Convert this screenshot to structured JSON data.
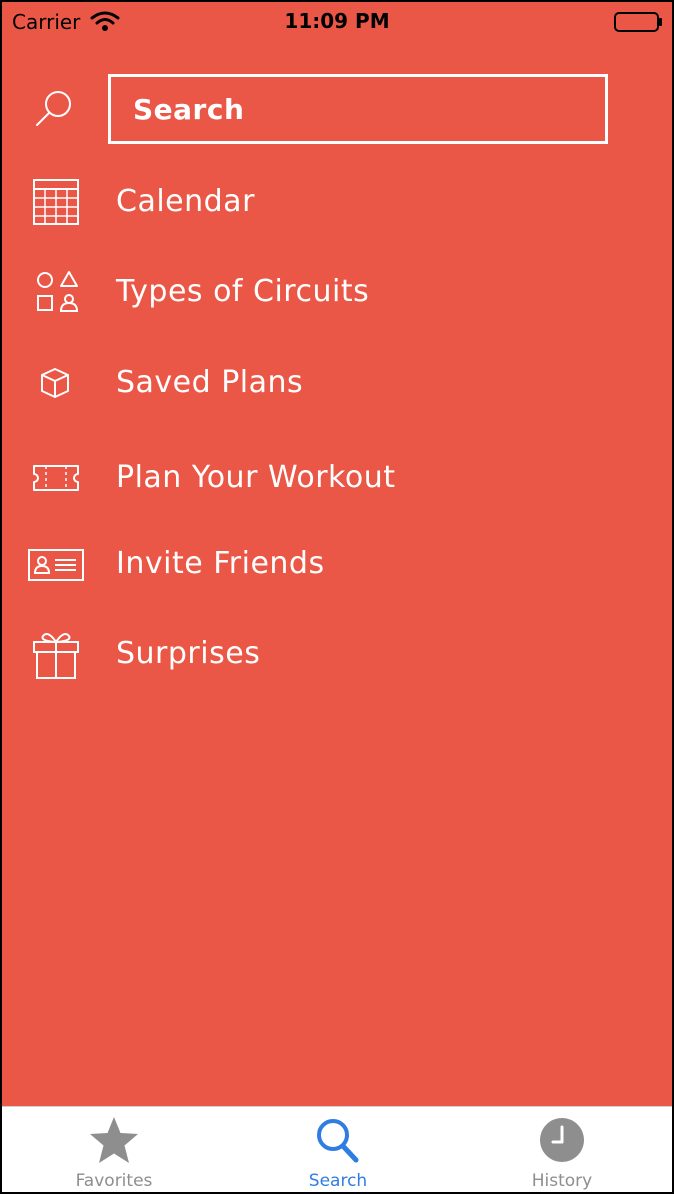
{
  "status_bar": {
    "carrier": "Carrier",
    "time": "11:09 PM"
  },
  "search": {
    "placeholder": "Search"
  },
  "menu": {
    "items": [
      {
        "label": "Calendar",
        "icon": "calendar-icon"
      },
      {
        "label": "Types of Circuits",
        "icon": "shapes-icon"
      },
      {
        "label": "Saved Plans",
        "icon": "box-icon"
      },
      {
        "label": "Plan Your Workout",
        "icon": "ticket-icon"
      },
      {
        "label": "Invite Friends",
        "icon": "id-card-icon"
      },
      {
        "label": "Surprises",
        "icon": "gift-icon"
      }
    ]
  },
  "tab_bar": {
    "tabs": [
      {
        "label": "Favorites",
        "icon": "star-icon",
        "active": false
      },
      {
        "label": "Search",
        "icon": "search-icon",
        "active": true
      },
      {
        "label": "History",
        "icon": "clock-icon",
        "active": false
      }
    ]
  },
  "colors": {
    "background": "#EB5746",
    "foreground": "#FFFFFF",
    "tab_active": "#2F7DE1",
    "tab_inactive": "#8E8E8E"
  }
}
